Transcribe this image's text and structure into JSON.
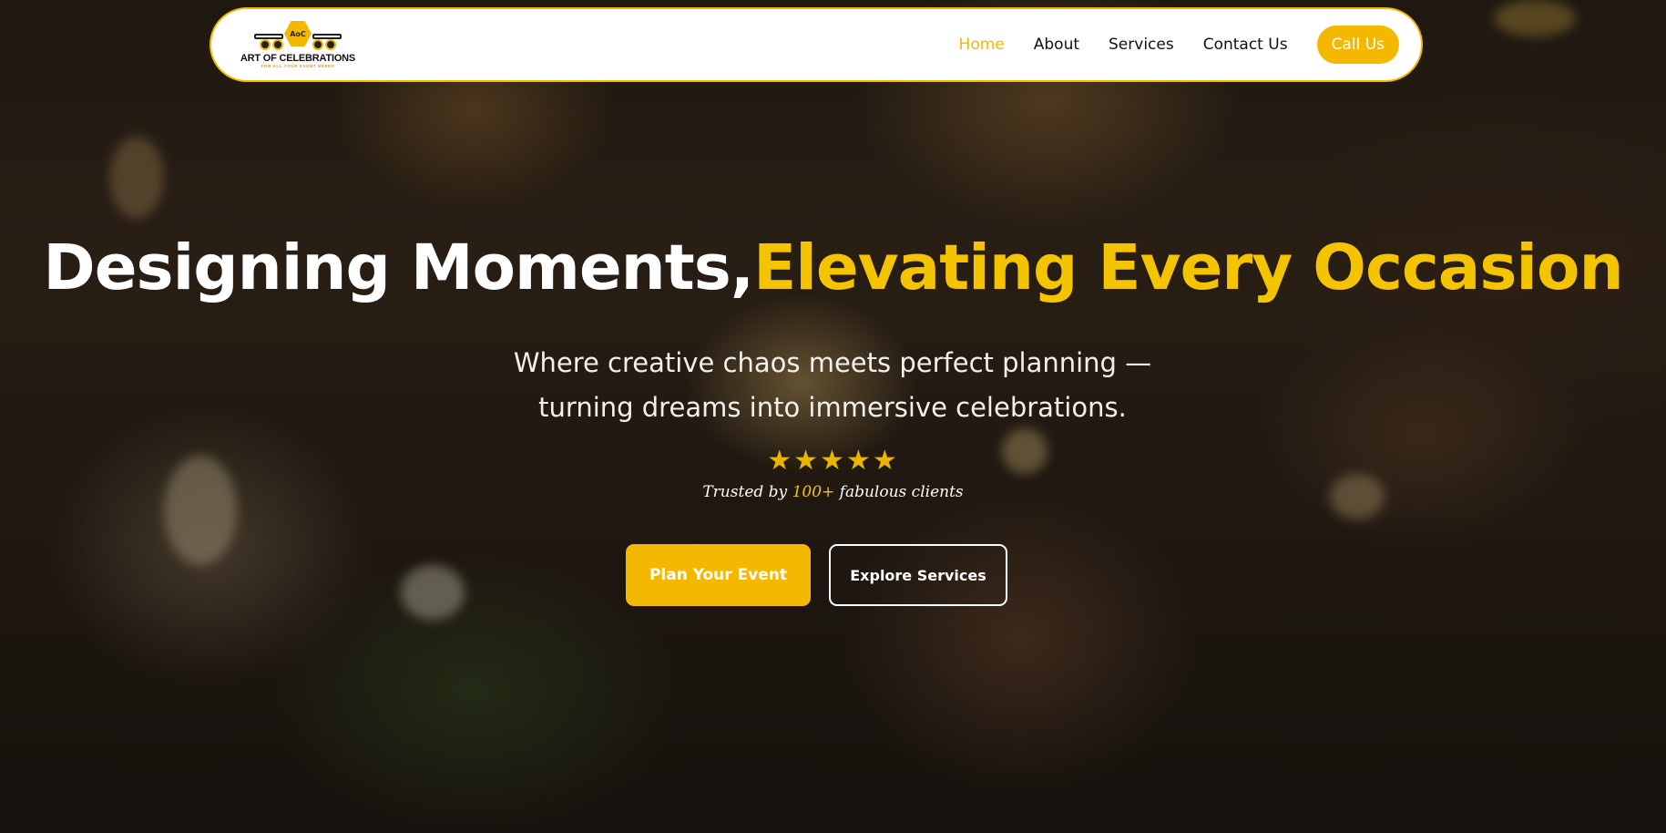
{
  "brand": {
    "name": "ART OF CELEBRATIONS",
    "tagline": "FOR ALL YOUR EVENT NEEDS",
    "badge": "AoC"
  },
  "nav": {
    "items": [
      {
        "label": "Home",
        "active": true
      },
      {
        "label": "About",
        "active": false
      },
      {
        "label": "Services",
        "active": false
      },
      {
        "label": "Contact Us",
        "active": false
      }
    ],
    "cta_label": "Call Us"
  },
  "hero": {
    "headline_white": "Designing Moments,",
    "headline_accent": "Elevating Every Occasion",
    "subtitle": "Where creative chaos meets perfect planning — turning dreams into immersive celebrations.",
    "rating": 5,
    "stars": "★★★★★",
    "trusted_prefix": "Trusted by",
    "trusted_count": "100+",
    "trusted_suffix": "fabulous clients",
    "primary_button": "Plan Your Event",
    "secondary_button": "Explore Services"
  },
  "colors": {
    "accent": "#f5b800",
    "headline_accent": "#f5c400",
    "nav_bg": "#ffffff",
    "text_dark": "#111111"
  },
  "icons": [
    "star-icon",
    "logo-icon"
  ]
}
